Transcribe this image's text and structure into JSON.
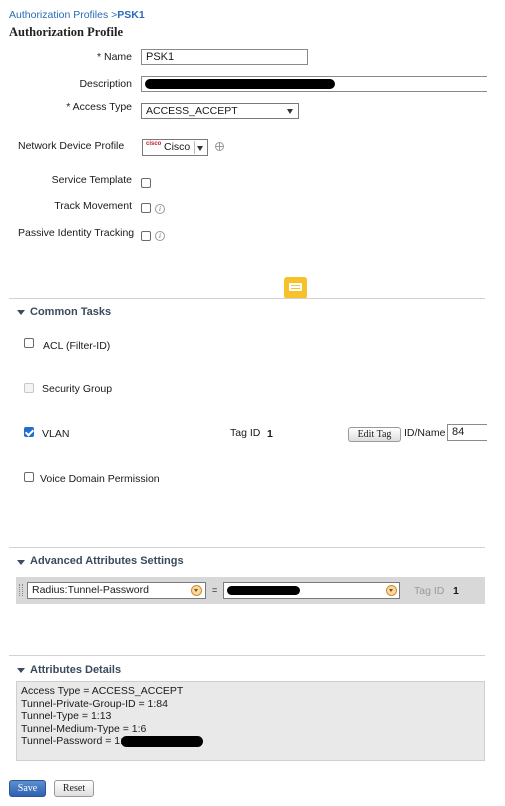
{
  "breadcrumb": {
    "parent": "Authorization Profiles",
    "separator": ">",
    "current": "PSK1"
  },
  "page_title": "Authorization Profile",
  "form": {
    "name_label": "* Name",
    "name_value": "PSK1",
    "description_label": "Description",
    "access_type_label": "* Access Type",
    "access_type_value": "ACCESS_ACCEPT",
    "ndp_label": "Network Device Profile",
    "ndp_logo_text": "cisco",
    "ndp_value": "Cisco",
    "service_template_label": "Service Template",
    "track_movement_label": "Track Movement",
    "passive_identity_label": "Passive Identity Tracking"
  },
  "common_tasks": {
    "title": "Common Tasks",
    "acl_label": "ACL  (Filter-ID)",
    "security_group_label": "Security Group",
    "vlan_label": "VLAN",
    "tag_id_label": "Tag ID",
    "tag_id_value": "1",
    "edit_tag_label": "Edit Tag",
    "id_name_label": "ID/Name",
    "id_name_value": "84",
    "voice_domain_label": "Voice Domain Permission"
  },
  "advanced": {
    "title": "Advanced Attributes Settings",
    "attribute_value": "Radius:Tunnel-Password",
    "equals": "=",
    "tag_id_label": "Tag ID",
    "tag_id_value": "1"
  },
  "details": {
    "title": "Attributes Details",
    "lines": [
      "Access Type = ACCESS_ACCEPT",
      "Tunnel-Private-Group-ID = 1:84",
      "Tunnel-Type = 1:13",
      "Tunnel-Medium-Type = 1:6",
      "Tunnel-Password = 1:"
    ]
  },
  "buttons": {
    "save": "Save",
    "reset": "Reset"
  },
  "colors": {
    "link": "#2a6ab8",
    "primary": "#2c62b0",
    "chat_badge": "#f6c12a"
  }
}
